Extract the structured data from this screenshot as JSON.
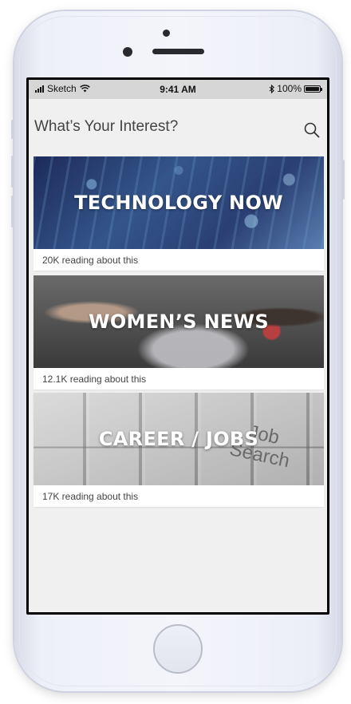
{
  "status_bar": {
    "carrier": "Sketch",
    "time": "9:41 AM",
    "battery_percent": "100%",
    "battery_level": 1.0
  },
  "header": {
    "title": "What’s Your Interest?",
    "search_icon": "search-icon"
  },
  "cards": [
    {
      "title": "TECHNOLOGY NOW",
      "meta": "20K reading about this"
    },
    {
      "title": "WOMEN’S NEWS",
      "meta": "12.1K reading about this"
    },
    {
      "title": "CAREER / JOBS",
      "meta": "17K reading about this",
      "key_text_1": "Job",
      "key_text_2": "Search"
    }
  ],
  "colors": {
    "status_bar_bg": "#d6d6d6",
    "screen_bg": "#f0f0f0",
    "title_text": "#444444",
    "card_title_text": "#ffffff"
  }
}
